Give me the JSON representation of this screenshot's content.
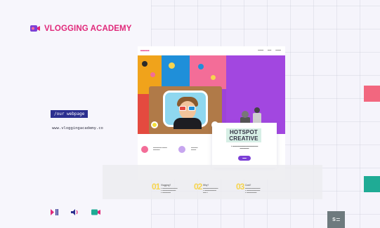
{
  "brand": {
    "name": "VLOGGING ACADEMY",
    "accent": "#e0287a"
  },
  "sidebar": {
    "tag_label": "/our webpage",
    "url_text": "www.vloggingacademy.co"
  },
  "controls": {
    "icons": [
      "play-pause-icon",
      "volume-icon",
      "video-camera-icon"
    ]
  },
  "website": {
    "card": {
      "title_line1": "HOTSPOT",
      "title_line2": "CREATIVE"
    }
  },
  "features": [
    {
      "num": "01",
      "title": "Vlogging?"
    },
    {
      "num": "02",
      "title": "Why?"
    },
    {
      "num": "03",
      "title": "Cost?"
    }
  ],
  "colors": {
    "pink_swatch": "#f2677f",
    "teal_swatch": "#1fab95",
    "tag_bg": "#2c2f8f"
  }
}
